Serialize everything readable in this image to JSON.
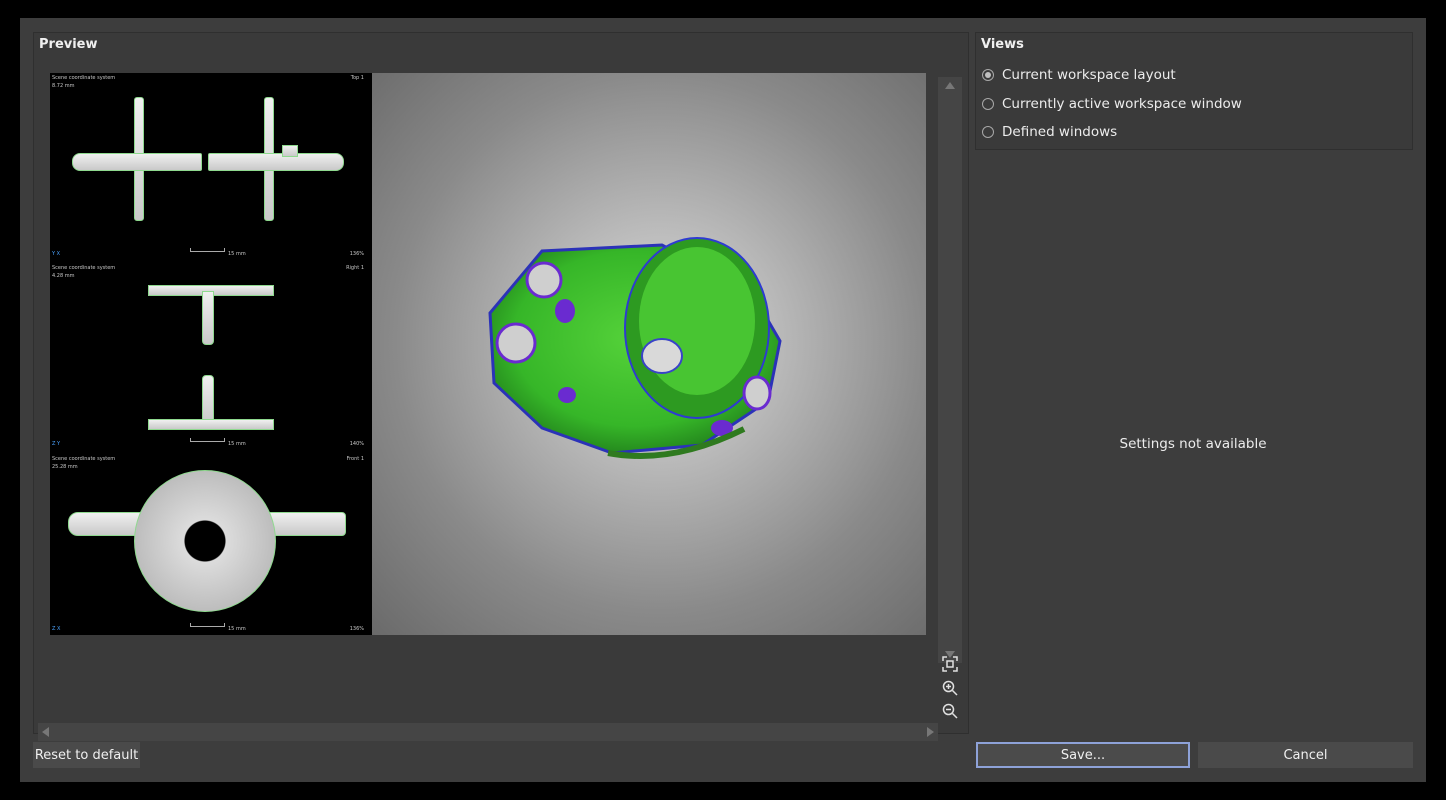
{
  "preview": {
    "title": "Preview",
    "slices": [
      {
        "coord_system": "Scene coordinate system",
        "measure": "8.72 mm",
        "view": "Top 1",
        "zoom": "136%",
        "scale": "15 mm",
        "axes": "Y X"
      },
      {
        "coord_system": "Scene coordinate system",
        "measure": "4.28 mm",
        "view": "Right 1",
        "zoom": "140%",
        "scale": "15 mm",
        "axes": "Z Y"
      },
      {
        "coord_system": "Scene coordinate system",
        "measure": "25.28 mm",
        "view": "Front 1",
        "zoom": "136%",
        "scale": "15 mm",
        "axes": "Z X"
      }
    ],
    "icons": {
      "fit": "fit-view-icon",
      "zoom_in": "zoom-in-icon",
      "zoom_out": "zoom-out-icon"
    }
  },
  "views": {
    "title": "Views",
    "options": [
      {
        "label": "Current workspace layout",
        "checked": true
      },
      {
        "label": "Currently active workspace window",
        "checked": false
      },
      {
        "label": "Defined windows",
        "checked": false
      }
    ]
  },
  "settings": {
    "message": "Settings not available"
  },
  "buttons": {
    "reset": "Reset to default",
    "save": "Save...",
    "cancel": "Cancel"
  },
  "colors": {
    "background": "#000000",
    "dialog": "#3d3d3d",
    "focus_border": "#8ea2d8",
    "part_green": "#3fbf2a",
    "part_purple": "#6a2bd0"
  }
}
